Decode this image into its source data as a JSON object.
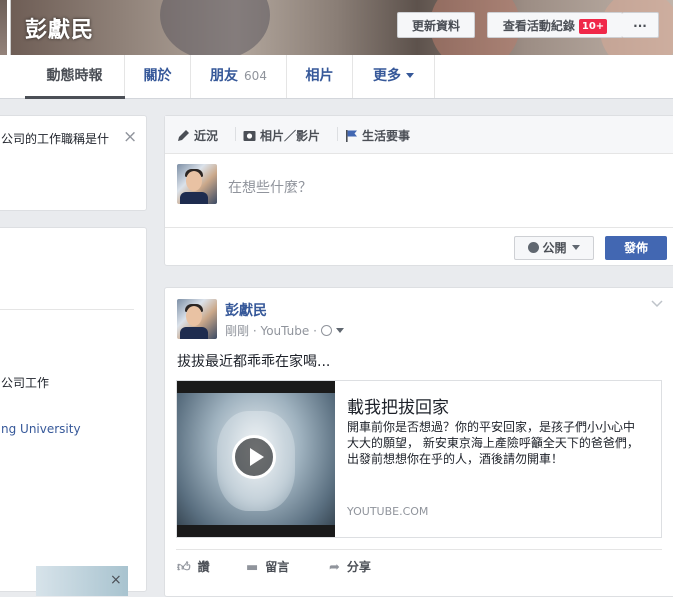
{
  "profile": {
    "name": "彭獻民",
    "update_info_label": "更新資料",
    "activity_log_label": "查看活動紀錄",
    "activity_badge": "10+",
    "more_label": "···"
  },
  "nav": {
    "tabs": [
      {
        "label": "動態時報"
      },
      {
        "label": "關於"
      },
      {
        "label": "朋友",
        "count": "604"
      },
      {
        "label": "相片"
      },
      {
        "label": "更多"
      }
    ]
  },
  "left_column": {
    "notice_text": "公司的工作職稱是什",
    "close_label": "×",
    "work_text": "公司工作",
    "school_text": "ng University",
    "bottom_close_label": "×"
  },
  "composer": {
    "tabs": [
      "近況",
      "相片／影片",
      "生活要事"
    ],
    "placeholder": "在想些什麼？",
    "privacy_label": "公開",
    "post_button_label": "發佈"
  },
  "post": {
    "author": "彭獻民",
    "time": "剛剛",
    "source": "YouTube",
    "text": "拔拔最近都乖乖在家喝...",
    "link": {
      "title": "載我把拔回家",
      "description": "開車前你是否想過？你的平安回家，是孩子們小小心中 大大的願望， 新安東京海上產險呼籲全天下的爸爸們，出發前想想你在乎的人，酒後請勿開車！",
      "domain": "YOUTUBE.COM"
    },
    "actions": [
      "讚",
      "留言",
      "分享"
    ]
  },
  "colors": {
    "link_blue": "#365899",
    "button_blue": "#4267b2",
    "badge_red": "#f02849",
    "page_bg": "#e9ebee"
  }
}
